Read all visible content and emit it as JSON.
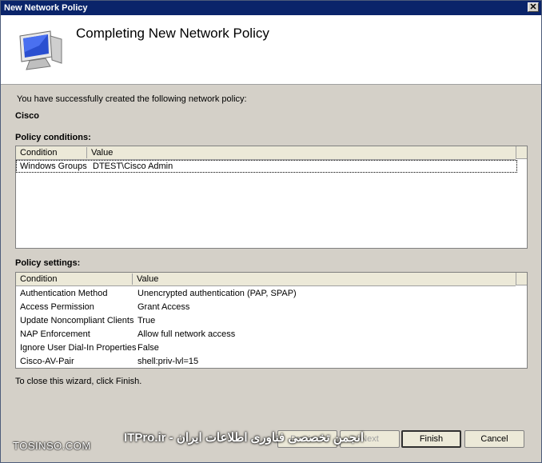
{
  "window": {
    "title": "New Network Policy"
  },
  "header": {
    "heading": "Completing New Network Policy"
  },
  "intro_text": "You have successfully created the following network policy:",
  "policy_name": "Cisco",
  "conditions": {
    "label": "Policy conditions:",
    "columns": [
      "Condition",
      "Value"
    ],
    "rows": [
      {
        "condition": "Windows Groups",
        "value": "DTEST\\Cisco Admin"
      }
    ]
  },
  "settings": {
    "label": "Policy settings:",
    "columns": [
      "Condition",
      "Value"
    ],
    "rows": [
      {
        "condition": "Authentication Method",
        "value": "Unencrypted authentication (PAP, SPAP)"
      },
      {
        "condition": "Access Permission",
        "value": "Grant Access"
      },
      {
        "condition": "Update Noncompliant Clients",
        "value": "True"
      },
      {
        "condition": "NAP Enforcement",
        "value": "Allow full network access"
      },
      {
        "condition": "Ignore User Dial-In Properties",
        "value": "False"
      },
      {
        "condition": "Cisco-AV-Pair",
        "value": "shell:priv-lvl=15"
      }
    ]
  },
  "close_text": "To close this wizard, click Finish.",
  "buttons": {
    "previous": "Previous",
    "next": "Next",
    "finish": "Finish",
    "cancel": "Cancel"
  },
  "watermark": {
    "left": "TOSINSO.COM",
    "center": "انجمن تخصصی فناوری اطلاعات ایران - ITPro.ir"
  }
}
